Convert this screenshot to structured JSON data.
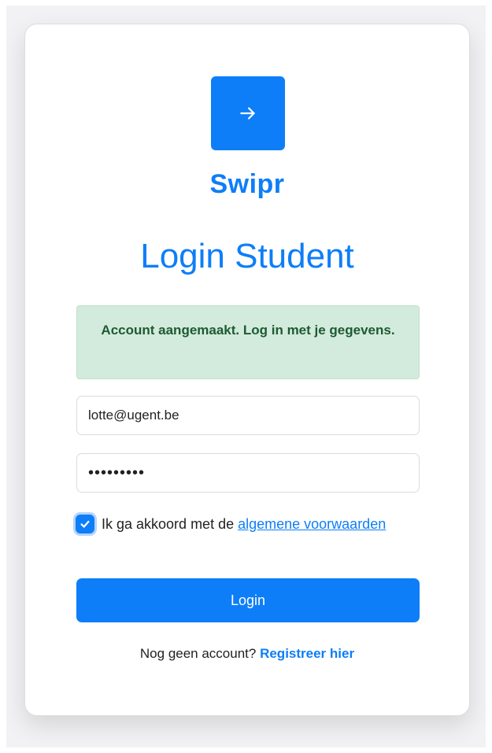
{
  "brand": {
    "name": "Swipr",
    "logo_icon": "arrow-right-icon",
    "color": "#0d7ef8"
  },
  "title": "Login Student",
  "alert": {
    "message": "Account aangemaakt. Log in met je gegevens.",
    "background": "#d3ebdc",
    "text_color": "#1d5a33"
  },
  "form": {
    "email_value": "lotte@ugent.be",
    "password_value": "•••••••••",
    "terms_checked": true,
    "terms_text": "Ik ga akkoord met de ",
    "terms_link": "algemene voorwaarden",
    "login_label": "Login"
  },
  "footer": {
    "prompt": "Nog geen account? ",
    "register_link": "Registreer hier"
  }
}
